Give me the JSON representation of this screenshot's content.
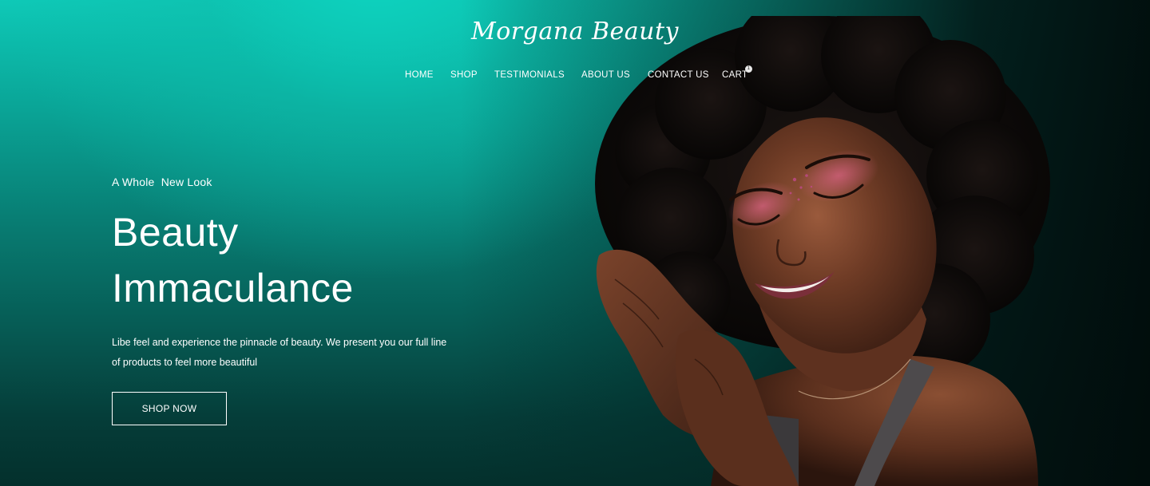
{
  "brand": {
    "logo_text": "Morgana Beauty"
  },
  "nav": {
    "items": [
      {
        "label": "HOME"
      },
      {
        "label": "SHOP"
      },
      {
        "label": "TESTIMONIALS"
      },
      {
        "label": "ABOUT US"
      },
      {
        "label": "CONTACT US"
      },
      {
        "label": "CART"
      }
    ],
    "cart_count": "1"
  },
  "hero": {
    "tagline": "A Whole  New Look",
    "headline_line1": "Beauty",
    "headline_line2": "Immaculance",
    "description": "Libe feel and experience the pinnacle of beauty. We present you our full line of products to feel more beautiful",
    "cta_label": "SHOP NOW",
    "image_alt": "woman-smiling-with-eyes-closed-photo"
  },
  "colors": {
    "teal_bright": "#0ec9b7",
    "teal_dark": "#053d39",
    "text": "#ffffff"
  }
}
